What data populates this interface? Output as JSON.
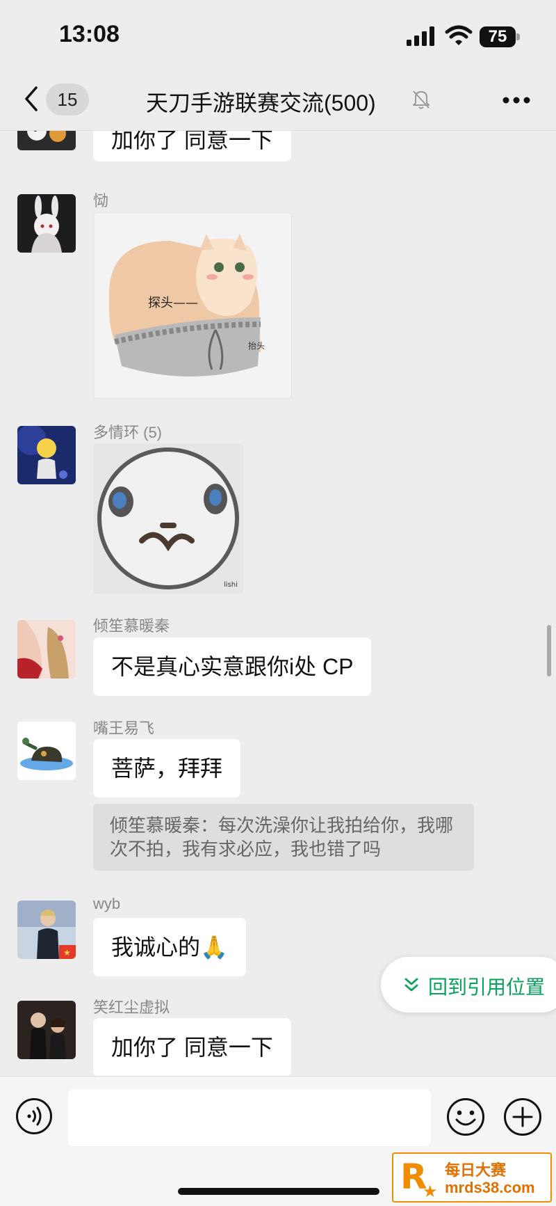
{
  "status_bar": {
    "time": "13:08",
    "battery": "75"
  },
  "nav": {
    "unread_count": "15",
    "title": "天刀手游联赛交流(500)"
  },
  "messages": [
    {
      "sender": "",
      "text": "加你了 同意一下"
    },
    {
      "sender": "恸",
      "sticker": "chubby-cat-sticker",
      "sticker_caption_1": "探头——",
      "sticker_caption_2": "抬头"
    },
    {
      "sender": "多情环 (5)",
      "sticker": "round-face-sticker",
      "sticker_caption": "lishi"
    },
    {
      "sender": "倾笙慕暖秦",
      "text": "不是真心实意跟你i处 CP"
    },
    {
      "sender": "嘴王易飞",
      "text": "菩萨，拜拜",
      "quote": "倾笙慕暖秦：每次洗澡你让我拍给你，我哪次不拍，我有求必应，我也错了吗"
    },
    {
      "sender": "wyb",
      "text": "我诚心的🙏"
    },
    {
      "sender": "笑红尘虚拟",
      "text": "加你了 同意一下"
    }
  ],
  "jump_button": {
    "label": "回到引用位置"
  },
  "input": {
    "placeholder": ""
  },
  "watermark": {
    "line1": "每日大赛",
    "line2": "mrds38.com"
  },
  "colors": {
    "background": "#ededed",
    "bubble": "#ffffff",
    "accent_green": "#07a35a"
  },
  "icons": [
    "back-icon",
    "mute-icon",
    "more-icon",
    "voice-icon",
    "emoji-icon",
    "plus-icon",
    "chevrons-down-icon"
  ]
}
